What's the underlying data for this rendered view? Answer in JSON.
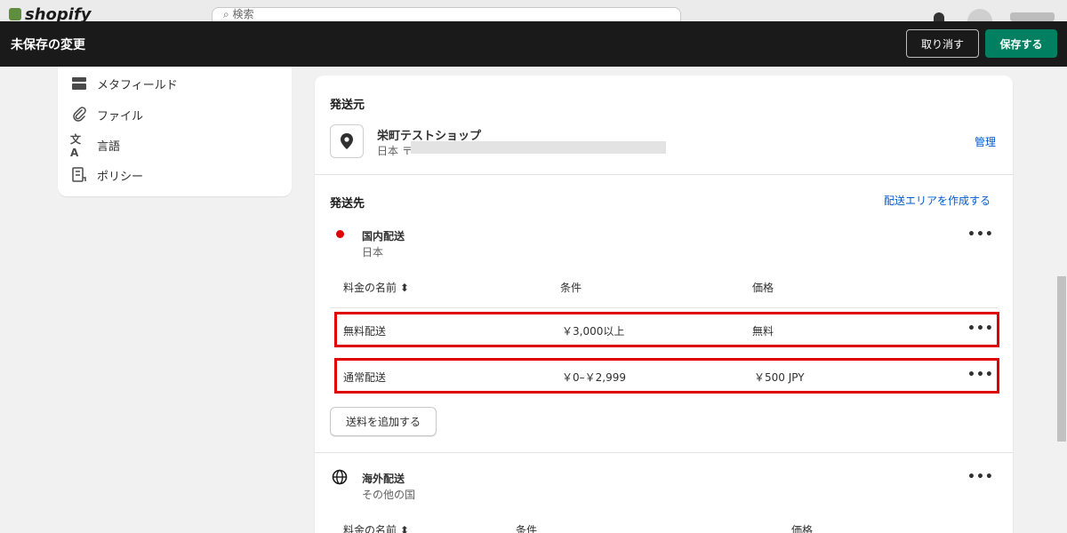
{
  "topbar": {
    "logo": "shopify",
    "search_placeholder": "検索"
  },
  "savebar": {
    "title": "未保存の変更",
    "discard": "取り消す",
    "save": "保存する"
  },
  "sidebar": {
    "items": [
      {
        "label": "メタフィールド",
        "icon": "metafield-icon"
      },
      {
        "label": "ファイル",
        "icon": "paperclip-icon"
      },
      {
        "label": "言語",
        "icon": "language-icon"
      },
      {
        "label": "ポリシー",
        "icon": "policy-icon"
      }
    ]
  },
  "origin": {
    "heading": "発送元",
    "shop_name": "栄町テストショップ",
    "address": "日本 〒",
    "manage": "管理"
  },
  "destination": {
    "heading": "発送先",
    "create_zone": "配送エリアを作成する",
    "domestic": {
      "name": "国内配送",
      "country": "日本",
      "headers": {
        "rate_name": "料金の名前 ⬍",
        "condition": "条件",
        "price": "価格"
      },
      "rates": [
        {
          "name": "無料配送",
          "condition": "￥3,000以上",
          "price": "無料"
        },
        {
          "name": "通常配送",
          "condition": "￥0–￥2,999",
          "price": "￥500 JPY"
        }
      ],
      "add_rate": "送料を追加する"
    },
    "international": {
      "name": "海外配送",
      "sub": "その他の国",
      "headers": {
        "rate_name": "料金の名前 ⬍",
        "condition": "条件",
        "price": "価格"
      }
    },
    "more": "•••"
  },
  "colors": {
    "accent_green": "#008060",
    "link_blue": "#005bd3",
    "highlight_red": "#e00000"
  }
}
